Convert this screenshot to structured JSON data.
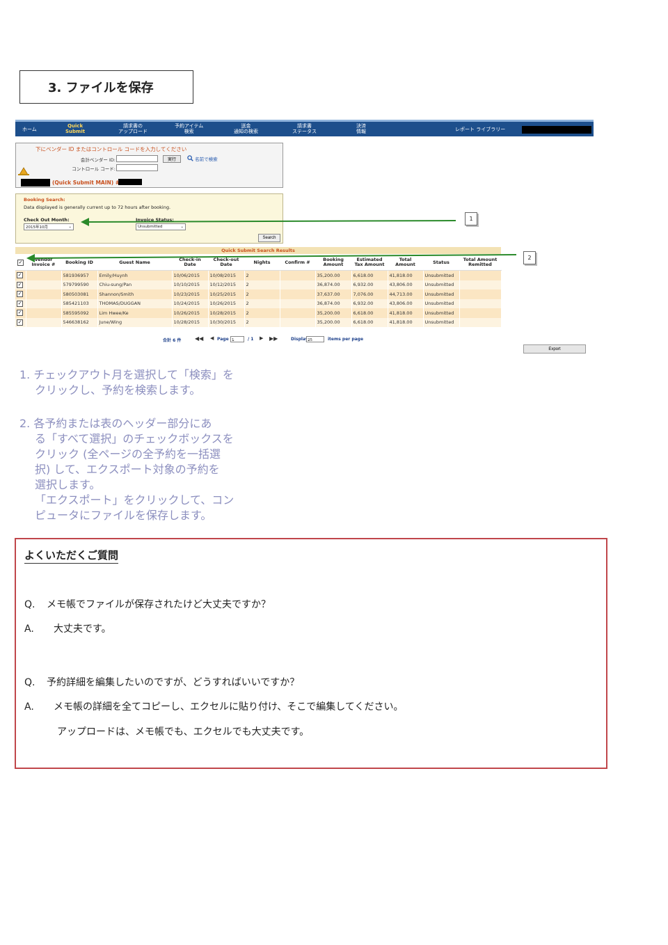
{
  "section_title": "3. ファイルを保存",
  "nav": {
    "items": [
      {
        "label": "ホーム",
        "active": false
      },
      {
        "label": "Quick\nSubmit",
        "active": true
      },
      {
        "label": "請求書の\nアップロード",
        "active": false
      },
      {
        "label": "予約アイテム\n検索",
        "active": false
      },
      {
        "label": "送金\n通知の検索",
        "active": false
      },
      {
        "label": "請求書\nステータス",
        "active": false
      },
      {
        "label": "決済\n情報",
        "active": false
      },
      {
        "label": "レポート ライブラリー",
        "active": false
      }
    ]
  },
  "vendor_panel": {
    "instruction": "下にベンダー ID またはコントロール コードを入力してください",
    "vendor_id_label": "会計ベンダー ID:",
    "control_code_label": "コントロール コード:",
    "execute_label": "実行",
    "name_search_label": "名前で検索",
    "main_label": "(Quick Submit MAIN) #"
  },
  "booking_search": {
    "title": "Booking Search:",
    "note": "Data displayed is generally current up to 72 hours after booking.",
    "checkout_label": "Check Out Month:",
    "checkout_value": "2015年10月",
    "invoice_status_label": "Invoice Status:",
    "invoice_status_value": "Unsubmitted",
    "search_label": "Search"
  },
  "results": {
    "title": "Quick Submit Search Results",
    "headers": [
      "",
      "Vendor Invoice #",
      "Booking ID",
      "Guest Name",
      "Check-in Date",
      "Check-out Date",
      "Nights",
      "Confirm #",
      "Booking Amount",
      "Estimated Tax Amount",
      "Total Amount",
      "Status",
      "Total Amount Remitted"
    ],
    "rows": [
      [
        "",
        "581936957",
        "Emily/Huynh",
        "10/06/2015",
        "10/08/2015",
        "2",
        "",
        "35,200.00",
        "6,618.00",
        "41,818.00",
        "Unsubmitted",
        ""
      ],
      [
        "",
        "579799590",
        "Chiu-sung/Pan",
        "10/10/2015",
        "10/12/2015",
        "2",
        "",
        "36,874.00",
        "6,932.00",
        "43,806.00",
        "Unsubmitted",
        ""
      ],
      [
        "",
        "580503081",
        "Shannon/Smith",
        "10/23/2015",
        "10/25/2015",
        "2",
        "",
        "37,637.00",
        "7,076.00",
        "44,713.00",
        "Unsubmitted",
        ""
      ],
      [
        "",
        "585421103",
        "THOMAS/DUGGAN",
        "10/24/2015",
        "10/26/2015",
        "2",
        "",
        "36,874.00",
        "6,932.00",
        "43,806.00",
        "Unsubmitted",
        ""
      ],
      [
        "",
        "585595092",
        "Lim Hwee/Ke",
        "10/26/2015",
        "10/28/2015",
        "2",
        "",
        "35,200.00",
        "6,618.00",
        "41,818.00",
        "Unsubmitted",
        ""
      ],
      [
        "",
        "546638162",
        "June/Wing",
        "10/28/2015",
        "10/30/2015",
        "2",
        "",
        "35,200.00",
        "6,618.00",
        "41,818.00",
        "Unsubmitted",
        ""
      ]
    ]
  },
  "pager": {
    "total": "合計 6 件",
    "page_label": "Page",
    "page_value": "1",
    "page_total": "/ 1",
    "display_label": "Display",
    "display_value": "25",
    "per_page_label": "items per page"
  },
  "export_label": "Export",
  "callouts": [
    "1",
    "2"
  ],
  "instructions": {
    "step1": [
      "1. チェックアウト月を選択して「検索」を",
      "クリックし、予約を検索します。"
    ],
    "step2": [
      "2. 各予約または表のヘッダー部分にあ",
      "る「すべて選択」のチェックボックスを",
      "クリック (全ページの全予約を一括選",
      "択) して、エクスポート対象の予約を",
      "選択します。",
      "「エクスポート」をクリックして、コン",
      "ピュータにファイルを保存します。"
    ]
  },
  "faq": {
    "title": "よくいただくご質問",
    "q1": "Q.",
    "q1_text": "メモ帳でファイルが保存されたけど大丈夫ですか？",
    "a1": "A.",
    "a1_text": "大丈夫です。",
    "q2": "Q.",
    "q2_text": "予約詳細を編集したいのですが、どうすればいいですか？",
    "a2": "A.",
    "a2_text": "メモ帳の詳細を全てコピーし、エクセルに貼り付け、そこで編集してください。",
    "a2_text2": "アップロードは、メモ帳でも、エクセルでも大丈夫です。"
  },
  "colors": {
    "nav_bg": "#1d4f8c",
    "accent_orange": "#c8501e",
    "arrow_green": "#2a8a2a",
    "faq_border": "#c0464a",
    "instruction_text": "#8c8fbf"
  }
}
